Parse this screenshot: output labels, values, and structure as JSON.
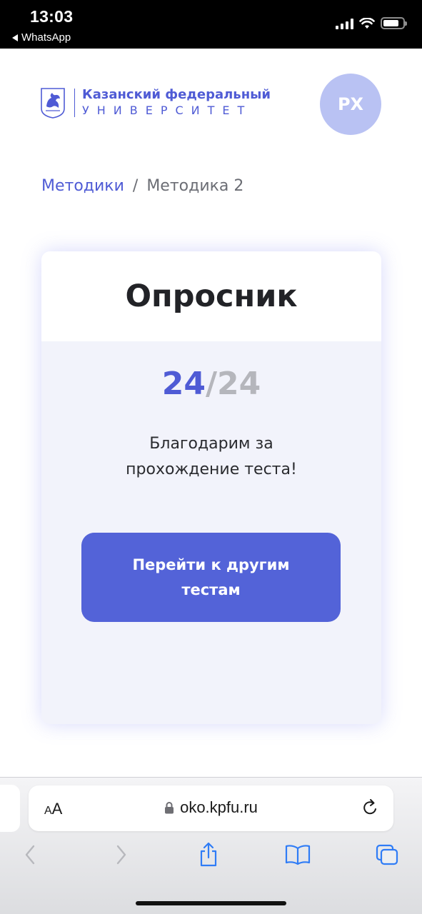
{
  "status_bar": {
    "time": "13:03",
    "back_app": "WhatsApp",
    "battery_level": 0.8
  },
  "header": {
    "logo": {
      "line1": "Казанский федеральный",
      "line2": "УНИВЕРСИТЕТ",
      "icon": "kfu-emblem-icon"
    },
    "avatar_initials": "РХ"
  },
  "breadcrumb": {
    "items": [
      {
        "label": "Методики",
        "link": true
      },
      {
        "label": "Методика 2",
        "link": false
      }
    ],
    "separator": "/"
  },
  "card": {
    "title": "Опросник",
    "progress": {
      "answered": "24",
      "separator": "/",
      "total": "24"
    },
    "message_line1": "Благодарим за",
    "message_line2": "прохождение теста!",
    "button_label": "Перейти к другим тестам"
  },
  "browser": {
    "text_size_label_small": "A",
    "text_size_label_big": "A",
    "url": "oko.kpfu.ru",
    "icons": {
      "lock": "lock-icon",
      "reload": "reload-icon",
      "back": "back-arrow-icon",
      "forward": "forward-arrow-icon",
      "share": "share-icon",
      "bookmarks": "bookmarks-icon",
      "tabs": "tabs-icon"
    }
  },
  "colors": {
    "accent": "#4f5bd5",
    "button": "#5363d8",
    "avatar": "#b9c2f3",
    "card_bg": "#f2f3fb",
    "muted": "#b5b6bc"
  }
}
